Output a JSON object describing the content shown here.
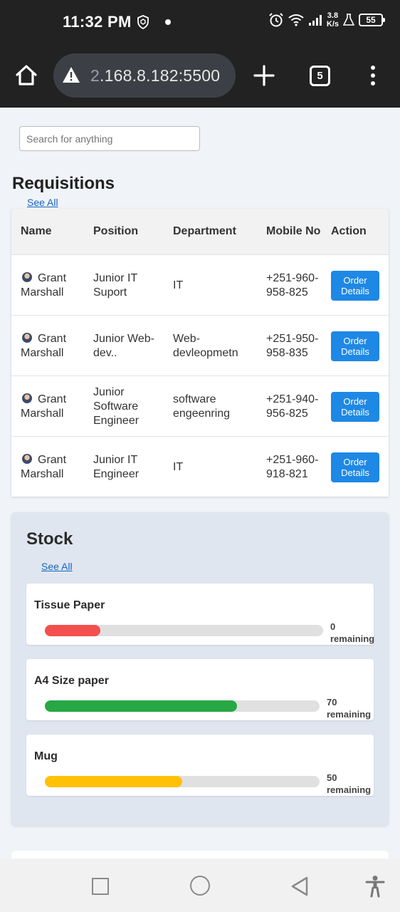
{
  "status_bar": {
    "time": "11:32 PM",
    "network_speed_value": "3.8",
    "network_speed_unit": "K/s",
    "battery": "55",
    "icons": [
      "shield-icon",
      "alarm-icon",
      "wifi-icon",
      "signal-icon",
      "flask-icon",
      "battery-icon"
    ]
  },
  "browser": {
    "url_prefix": "2",
    "url_rest": ".168.8.182:5500",
    "tab_count": "5",
    "icons": [
      "home-icon",
      "warning-icon",
      "plus-icon",
      "tabs-icon",
      "more-vert-icon"
    ]
  },
  "search": {
    "placeholder": "Search for anything"
  },
  "requisitions": {
    "title": "Requisitions",
    "see_all": "See All",
    "headers": {
      "name": "Name",
      "position": "Position",
      "department": "Department",
      "mobile": "Mobile No",
      "action": "Action"
    },
    "rows": [
      {
        "name": "Grant Marshall",
        "position": "Junior IT Suport",
        "department": "IT",
        "mobile": "+251-960-958-825",
        "action": "Order Details"
      },
      {
        "name": "Grant Marshall",
        "position": "Junior Web-dev..",
        "department": "Web-devleopmetn",
        "mobile": "+251-950-958-835",
        "action": "Order Details"
      },
      {
        "name": "Grant Marshall",
        "position": "Junior Software Engineer",
        "department": "software engeenring",
        "mobile": "+251-940-956-825",
        "action": "Order Details"
      },
      {
        "name": "Grant Marshall",
        "position": "Junior IT Engineer",
        "department": "IT",
        "mobile": "+251-960-918-821",
        "action": "Order Details"
      }
    ]
  },
  "stock": {
    "title": "Stock",
    "see_all": "See All",
    "items": [
      {
        "name": "Tissue Paper",
        "count": "0",
        "remaining_label": "remaining",
        "level": 0.2,
        "color": "#f44f4f"
      },
      {
        "name": "A4 Size paper",
        "count": "70",
        "remaining_label": "remaining",
        "level": 0.7,
        "color": "#28a745"
      },
      {
        "name": "Mug",
        "count": "50",
        "remaining_label": "remaining",
        "level": 0.5,
        "color": "#ffc107"
      }
    ]
  },
  "nav_bar": {
    "icons": [
      "recents-square-icon",
      "home-circle-icon",
      "back-triangle-icon",
      "accessibility-icon"
    ]
  }
}
